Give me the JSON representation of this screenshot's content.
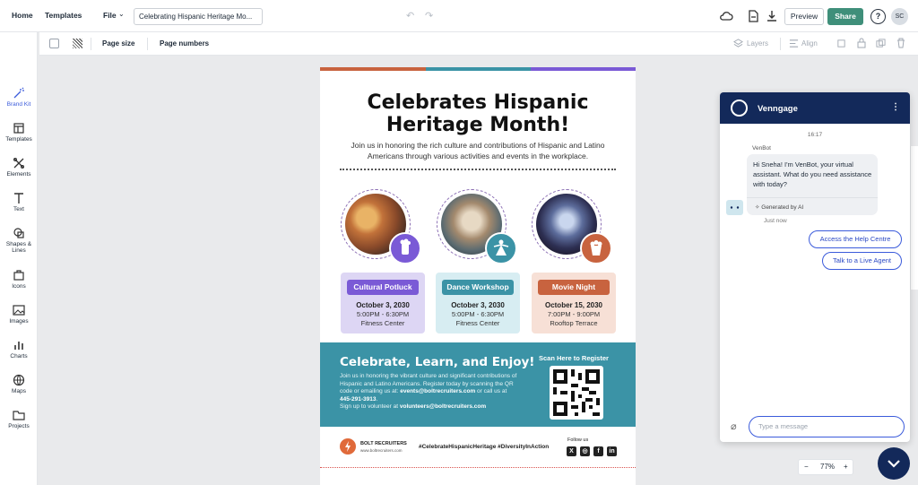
{
  "topbar": {
    "home": "Home",
    "templates": "Templates",
    "file": "File",
    "doc_title": "Celebrating Hispanic Heritage Mo...",
    "preview": "Preview",
    "share": "Share",
    "help": "?",
    "avatar": "SC"
  },
  "toolbar2": {
    "page_size": "Page size",
    "page_numbers": "Page numbers",
    "layers": "Layers",
    "align": "Align"
  },
  "sidebar": {
    "items": [
      {
        "label": "Brand Kit",
        "icon": "magic-wand-icon"
      },
      {
        "label": "Templates",
        "icon": "templates-icon"
      },
      {
        "label": "Elements",
        "icon": "elements-icon"
      },
      {
        "label": "Text",
        "icon": "text-icon"
      },
      {
        "label": "Shapes & Lines",
        "icon": "shapes-icon"
      },
      {
        "label": "Icons",
        "icon": "icons-icon"
      },
      {
        "label": "Images",
        "icon": "image-icon"
      },
      {
        "label": "Charts",
        "icon": "chart-icon"
      },
      {
        "label": "Maps",
        "icon": "globe-icon"
      },
      {
        "label": "Projects",
        "icon": "folder-icon"
      }
    ]
  },
  "poster": {
    "title_line1": "Celebrates Hispanic",
    "title_line2": "Heritage Month!",
    "subtitle": "Join us in honoring the rich culture and contributions of Hispanic and Latino Americans through various activities and events in the workplace.",
    "events": [
      {
        "tag": "Cultural Potluck",
        "date": "October 3, 2030",
        "time": "5:00PM - 6:30PM",
        "location": "Fitness Center",
        "tag_color": "#7a5ad6",
        "card_color": "#ddd6f4"
      },
      {
        "tag": "Dance Workshop",
        "date": "October 3, 2030",
        "time": "5:00PM - 6:30PM",
        "location": "Fitness Center",
        "tag_color": "#3b93a6",
        "card_color": "#d7edf2"
      },
      {
        "tag": "Movie Night",
        "date": "October 15, 2030",
        "time": "7:00PM - 9:00PM",
        "location": "Rooftop Terrace",
        "tag_color": "#c8633f",
        "card_color": "#f7e0d6"
      }
    ],
    "band_title": "Celebrate, Learn, and Enjoy!",
    "band_text_1": "Join us in honoring the vibrant culture and significant contributions of Hispanic and Latino Americans. Register today by scanning the QR code or emailing us at:",
    "band_email_1": "events@boltrecruiters.com",
    "band_text_2": " or call us at ",
    "band_phone": "445-291-3913",
    "band_text_3": "Sign up to volunteer at ",
    "band_email_2": "volunteers@boltrecruiters.com",
    "scan_label": "Scan Here to Register",
    "brand": "BOLT RECRUITERS",
    "brand_url": "www.boltrecruiters.com",
    "hashtags": "#CelebrateHispanicHeritage #DiversityInAction",
    "follow": "Follow us"
  },
  "zoom": {
    "minus": "−",
    "value": "77%",
    "plus": "+"
  },
  "chat": {
    "name": "Venngage",
    "time": "16:17",
    "sender": "VenBot",
    "message": "Hi Sneha! I'm VenBot, your virtual assistant. What do you need assistance with today?",
    "ai_note": "Generated by AI",
    "just_now": "Just now",
    "chip_help": "Access the Help Centre",
    "chip_agent": "Talk to a Live Agent",
    "input_placeholder": "Type a message"
  },
  "colors": {
    "accent": "#3b5bdb",
    "share": "#3f8f7a",
    "chat_header": "#13295a",
    "band": "#3b93a6"
  }
}
